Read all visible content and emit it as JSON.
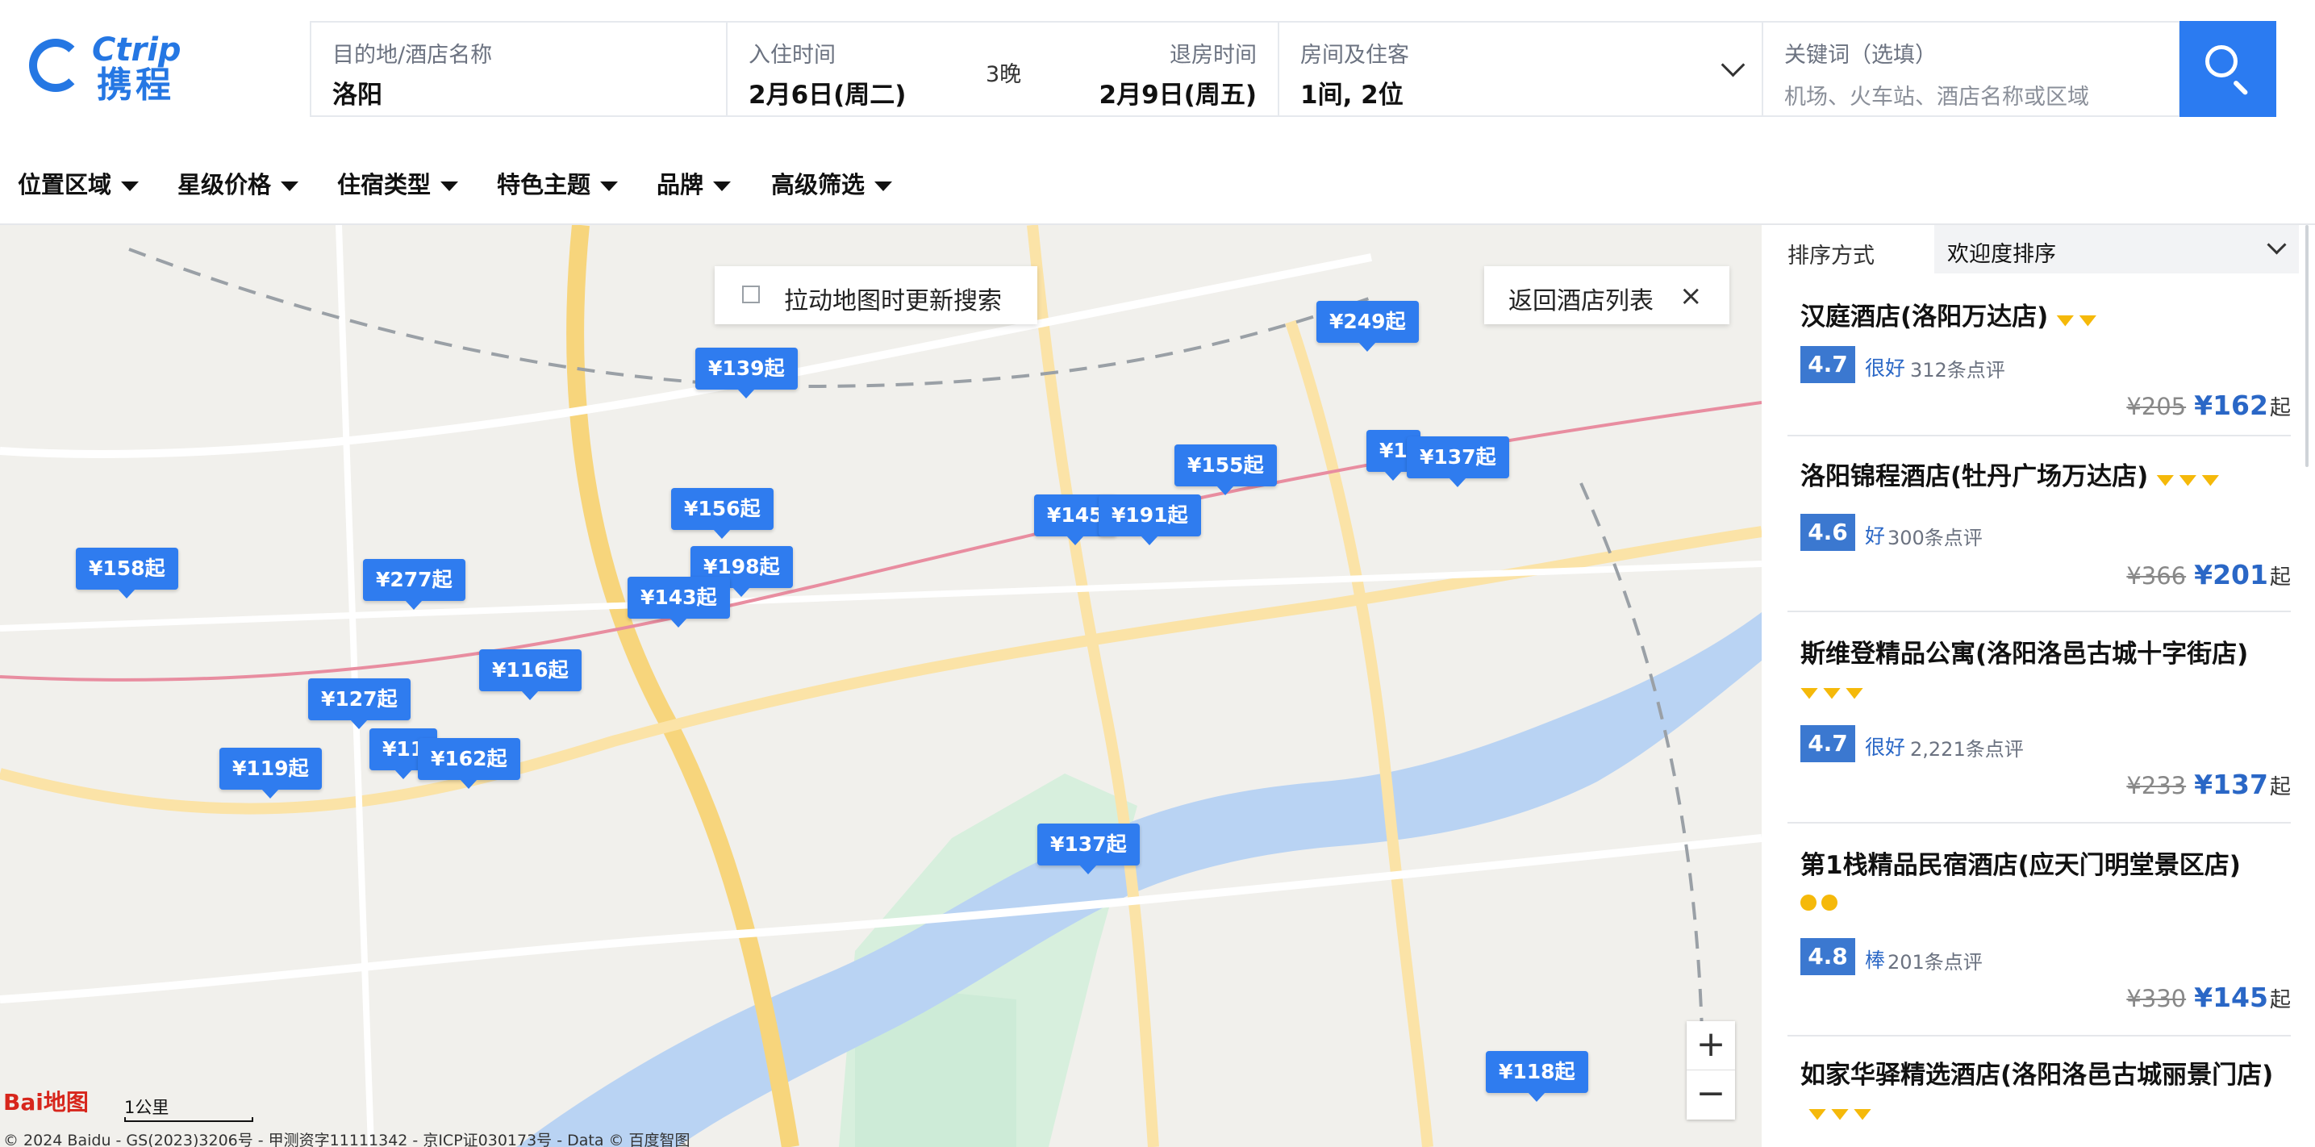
{
  "brand": {
    "logo_en": "Ctrip",
    "logo_cn": "携程"
  },
  "search": {
    "destination_label": "目的地/酒店名称",
    "destination_value": "洛阳",
    "checkin_label": "入住时间",
    "checkin_value": "2月6日(周二)",
    "nights": "3晚",
    "checkout_label": "退房时间",
    "checkout_value": "2月9日(周五)",
    "rooms_label": "房间及住客",
    "rooms_value": "1间, 2位",
    "keyword_label": "关键词（选填）",
    "keyword_placeholder": "机场、火车站、酒店名称或区域"
  },
  "filters": [
    "位置区域",
    "星级价格",
    "住宿类型",
    "特色主题",
    "品牌",
    "高级筛选"
  ],
  "map": {
    "toggle_label": "拉动地图时更新搜索",
    "back_label": "返回酒店列表",
    "zoom_in": "+",
    "zoom_out": "−",
    "scale": "1公里",
    "baidu": "Bai地图",
    "copyright": "© 2024 Baidu - GS(2023)3206号 - 甲测资字11111342 - 京ICP证030173号 - Data © 百度智图",
    "price_pins": [
      {
        "label": "¥139起"
      },
      {
        "label": "¥249起"
      },
      {
        "label": "¥155起"
      },
      {
        "label": "¥137起"
      },
      {
        "label": "¥156起"
      },
      {
        "label": "¥198起"
      },
      {
        "label": "¥143起"
      },
      {
        "label": "¥145"
      },
      {
        "label": "¥191起"
      },
      {
        "label": "¥158起"
      },
      {
        "label": "¥277起"
      },
      {
        "label": "¥116起"
      },
      {
        "label": "¥127起"
      },
      {
        "label": "¥11"
      },
      {
        "label": "¥162起"
      },
      {
        "label": "¥119起"
      },
      {
        "label": "¥137起"
      },
      {
        "label": "¥118起"
      },
      {
        "label": "¥1"
      }
    ]
  },
  "sort": {
    "label": "排序方式",
    "value": "欢迎度排序"
  },
  "hotels": [
    {
      "name": "汉庭酒店(洛阳万达店)",
      "badge": "gem",
      "badge_count": 2,
      "score": "4.7",
      "grade": "很好",
      "reviews": "312条点评",
      "orig": "¥205",
      "price": "¥162",
      "unit": "起"
    },
    {
      "name": "洛阳锦程酒店(牡丹广场万达店)",
      "badge": "gem",
      "badge_count": 3,
      "score": "4.6",
      "grade": "好",
      "reviews": "300条点评",
      "orig": "¥366",
      "price": "¥201",
      "unit": "起"
    },
    {
      "name": "斯维登精品公寓(洛阳洛邑古城十字街店)",
      "badge": "gem",
      "badge_count": 3,
      "score": "4.7",
      "grade": "很好",
      "reviews": "2,221条点评",
      "orig": "¥233",
      "price": "¥137",
      "unit": "起"
    },
    {
      "name": "第1栈精品民宿酒店(应天门明堂景区店)",
      "badge": "dot",
      "badge_count": 2,
      "score": "4.8",
      "grade": "棒",
      "reviews": "201条点评",
      "orig": "¥330",
      "price": "¥145",
      "unit": "起"
    },
    {
      "name": "如家华驿精选酒店(洛阳洛邑古城丽景门店)",
      "badge": "gem",
      "badge_count": 3
    }
  ],
  "colors": {
    "accent": "#2b7bf1",
    "pin": "#2f7cef",
    "score": "#3b78d0",
    "river": "#b9d3f3",
    "park": "#cdebd7",
    "road_major": "#f7d57c",
    "badge": "#f5b90a"
  }
}
